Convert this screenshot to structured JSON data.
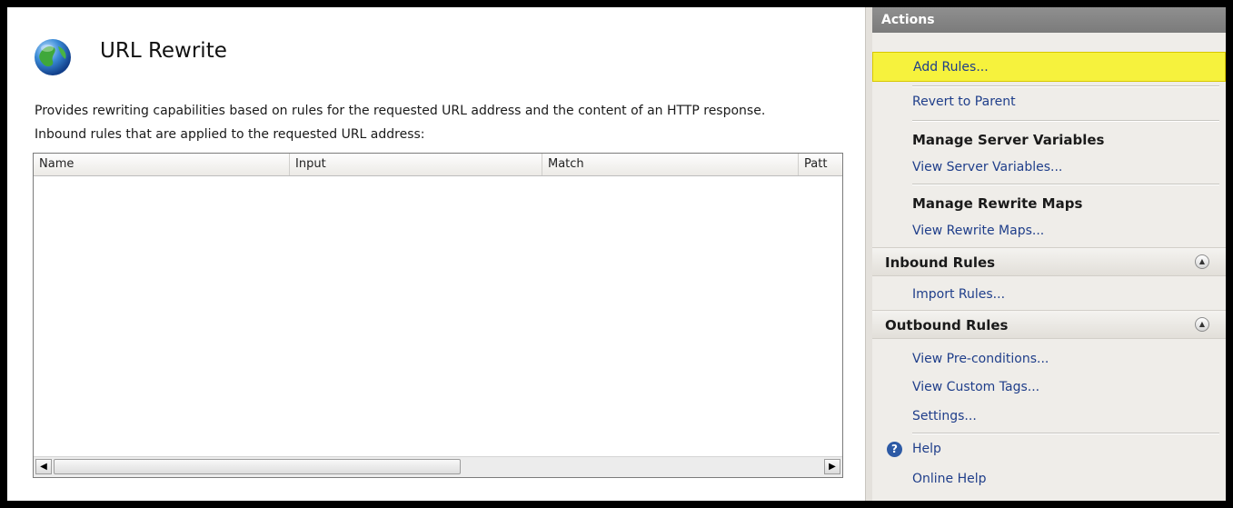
{
  "main": {
    "title": "URL Rewrite",
    "description": "Provides rewriting capabilities based on rules for the requested URL address and the content of an HTTP response.",
    "subdescription": "Inbound rules that are applied to the requested URL address:",
    "table": {
      "columns": [
        "Name",
        "Input",
        "Match",
        "Patt"
      ],
      "rows": []
    },
    "icon": "globe-icon"
  },
  "actions": {
    "header": "Actions",
    "items": {
      "add_rules": "Add Rules...",
      "revert_to_parent": "Revert to Parent",
      "manage_server_variables": "Manage Server Variables",
      "view_server_variables": "View Server Variables...",
      "manage_rewrite_maps": "Manage Rewrite Maps",
      "view_rewrite_maps": "View Rewrite Maps...",
      "inbound_rules": "Inbound Rules",
      "import_rules": "Import Rules...",
      "outbound_rules": "Outbound Rules",
      "view_preconditions": "View Pre-conditions...",
      "view_custom_tags": "View Custom Tags...",
      "settings": "Settings...",
      "help": "Help",
      "online_help": "Online Help"
    },
    "highlight_color": "#f6f23d"
  }
}
